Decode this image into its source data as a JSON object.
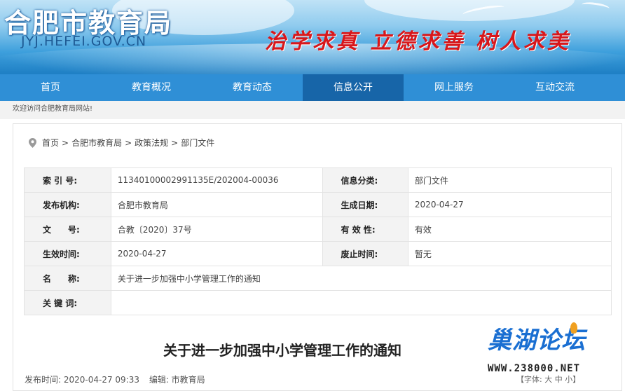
{
  "header": {
    "site_name": "合肥市教育局",
    "site_url": "JYJ.HEFEI.GOV.CN",
    "slogan": "治学求真 立德求善 树人求美"
  },
  "nav": {
    "items": [
      "首页",
      "教育概况",
      "教育动态",
      "信息公开",
      "网上服务",
      "互动交流"
    ],
    "active": "信息公开"
  },
  "welcome_text": "欢迎访问合肥教育局网站!",
  "breadcrumb": [
    "首页",
    "合肥市教育局",
    "政策法规",
    "部门文件"
  ],
  "breadcrumb_sep": ">",
  "meta": {
    "index_label": "索 引 号:",
    "index_value": "11340100002991135E/202004-00036",
    "category_label": "信息分类:",
    "category_value": "部门文件",
    "publisher_label": "发布机构:",
    "publisher_value": "合肥市教育局",
    "gen_date_label": "生成日期:",
    "gen_date_value": "2020-04-27",
    "doc_no_label": "文　　号:",
    "doc_no_value": "合教〔2020〕37号",
    "validity_label": "有 效 性:",
    "validity_value": "有效",
    "effective_label": "生效时间:",
    "effective_value": "2020-04-27",
    "repeal_label": "废止时间:",
    "repeal_value": "暂无",
    "name_label": "名　　称:",
    "name_value": "关于进一步加强中小学管理工作的通知",
    "keywords_label": "关 键 词:",
    "keywords_value": ""
  },
  "article": {
    "title": "关于进一步加强中小学管理工作的通知",
    "publish_time": "发布时间:  2020-04-27 09:33",
    "editor": "编辑:  市教育局",
    "font_size_label": "【字体: 大 中 小】"
  },
  "watermark": {
    "name": "巢湖论坛",
    "url": "WWW.238000.NET"
  },
  "colors": {
    "nav_bg": "#2f8fd6",
    "nav_active": "#1765a8",
    "slogan": "#d8171b",
    "watermark": "#1a6fd2"
  }
}
